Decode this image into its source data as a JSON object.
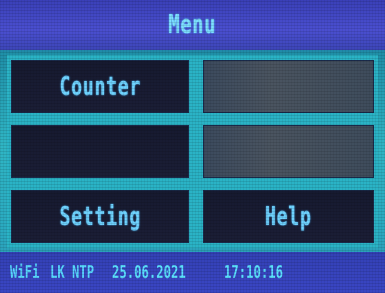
{
  "header": {
    "title": "Menu"
  },
  "menu": {
    "tiles": [
      {
        "label": "Counter"
      },
      {
        "label": ""
      },
      {
        "label": ""
      },
      {
        "label": ""
      },
      {
        "label": "Setting"
      },
      {
        "label": "Help"
      }
    ]
  },
  "status": {
    "wifi": "WiFi",
    "lk": "LK",
    "ntp": "NTP",
    "date": "25.06.2021",
    "time": "17:10:16"
  },
  "colors": {
    "title_bar": "#4a4fd0",
    "background": "#2ab3c6",
    "tile": "#1b1e36",
    "text": "#6fd3ff"
  }
}
